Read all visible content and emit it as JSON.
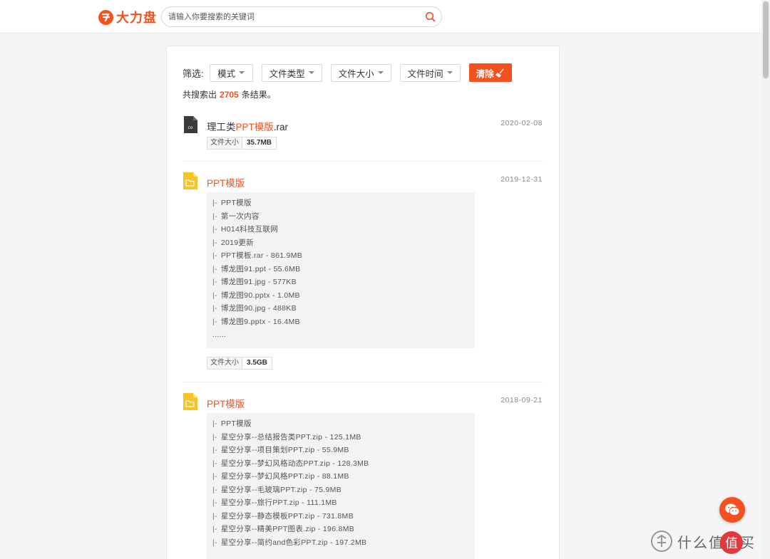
{
  "header": {
    "logo_text": "大力盘",
    "search_placeholder": "请输入你要搜索的关键词"
  },
  "filters": {
    "label": "筛选:",
    "options": [
      "模式",
      "文件类型",
      "文件大小",
      "文件时间"
    ],
    "clear_label": "清除"
  },
  "results": {
    "prefix": "共搜索出",
    "count": "2705",
    "suffix": "条结果。",
    "items": [
      {
        "title_parts": [
          "理工类",
          "PPT模版",
          ".rar"
        ],
        "date": "2020-02-08",
        "size_label": "文件大小",
        "size_value": "35.7MB"
      },
      {
        "title": "PPT模版",
        "date": "2019-12-31",
        "files": [
          "PPT模版",
          "第一次内容",
          "H014科技互联网",
          "2019更新",
          "PPT模板.rar - 861.9MB",
          "博龙图91.ppt - 55.6MB",
          "博龙图91.jpg - 577KB",
          "博龙图90.pptx - 1.0MB",
          "博龙图90.jpg - 488KB",
          "博龙图9.pptx - 16.4MB"
        ],
        "more": "......",
        "size_label": "文件大小",
        "size_value": "3.5GB"
      },
      {
        "title": "PPT模版",
        "date": "2018-09-21",
        "files": [
          "PPT模版",
          "星空分享--总结报告类PPT.zip - 125.1MB",
          "星空分享--项目策划PPT.zip - 55.9MB",
          "星空分享--梦幻风格动态PPT.zip - 128.3MB",
          "星空分享--梦幻风格PPT.zip - 88.1MB",
          "星空分享--毛玻璃PPT.zip - 75.9MB",
          "星空分享--旅行PPT.zip - 111.1MB",
          "星空分享--静态模板PPT.zip - 731.8MB",
          "星空分享--精美PPT图表.zip - 196.8MB",
          "星空分享--简约and色彩PPT.zip - 197.2MB"
        ]
      }
    ],
    "tree_prefix": "|-"
  },
  "watermark": {
    "text": "什么值得买",
    "badge": "值"
  },
  "colors": {
    "accent": "#f4511e",
    "folder": "#f7c325",
    "rar": "#3a3a3a"
  }
}
